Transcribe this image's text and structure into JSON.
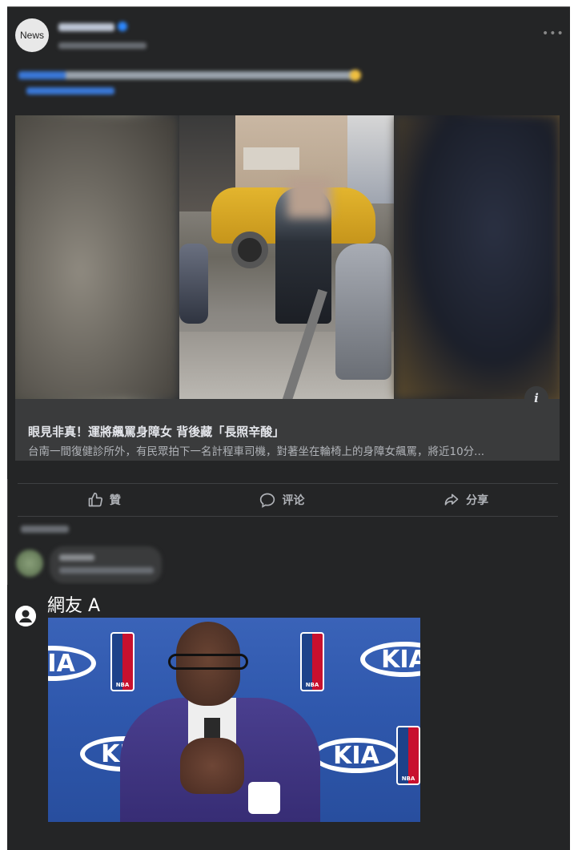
{
  "post": {
    "page_avatar_label": "News",
    "link": {
      "title": "眼見非真！運將飆罵身障女 背後藏「長照辛酸」",
      "description": "台南一間復健診所外，有民眾拍下一名計程車司機，對著坐在輪椅上的身障女飆罵，將近10分..."
    },
    "actions": {
      "like": "贊",
      "comment": "评论",
      "share": "分享"
    }
  },
  "meme": {
    "user_name": "網友 A",
    "kia": "KIA",
    "nba": "NBA"
  },
  "colors": {
    "background": "#242526",
    "link_preview": "#3a3b3c",
    "text_primary": "#e4e6eb",
    "text_secondary": "#b0b3b8",
    "meme_backdrop": "#2f58ad"
  },
  "icons": {
    "like": "thumbs-up-icon",
    "comment": "speech-bubble-icon",
    "share": "share-arrow-icon",
    "info": "info-icon",
    "user": "user-icon",
    "more": "more-icon"
  }
}
